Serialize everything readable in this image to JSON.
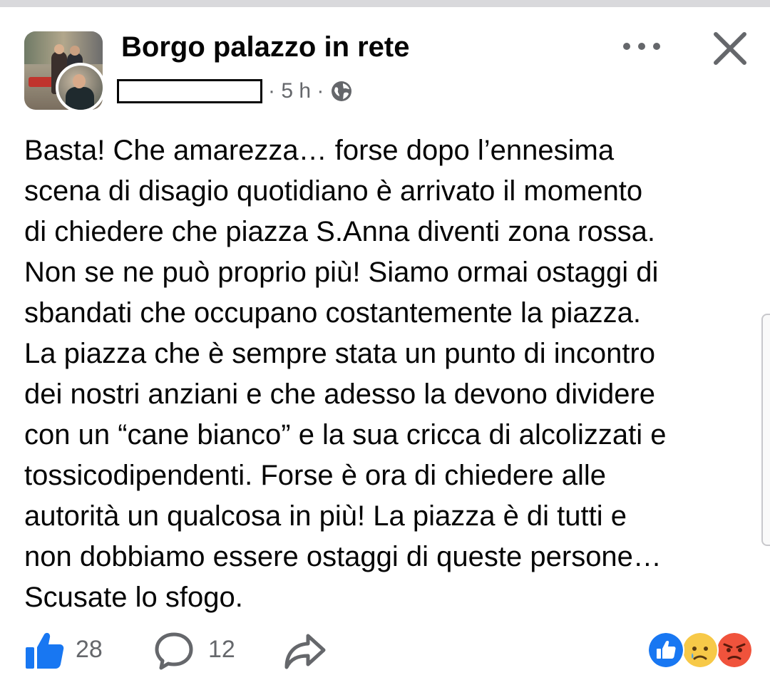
{
  "post": {
    "page_name": "Borgo palazzo in rete",
    "author_name": "",
    "meta": "· 5 h ·",
    "visibility_icon": "globe-icon",
    "body": "Basta! Che amarezza… forse dopo l’ennesima\nscena di disagio quotidiano è arrivato il momento\ndi chiedere che piazza S.Anna diventi zona rossa.\nNon se ne può proprio più! Siamo ormai ostaggi di\nsbandati che occupano costantemente la piazza.\nLa piazza che è sempre stata un punto di incontro\ndei nostri anziani e che adesso la devono dividere\ncon un “cane bianco” e la sua cricca di alcolizzati e\ntossicodipendenti. Forse è ora di chiedere alle\nautorità un qualcosa in più! La piazza è di tutti e\nnon dobbiamo essere ostaggi di queste persone…\nScusate lo sfogo."
  },
  "footer": {
    "like_count": "28",
    "comment_count": "12",
    "reactions": [
      "like-icon",
      "sad-icon",
      "angry-icon"
    ]
  },
  "colors": {
    "accent_blue": "#1877f2",
    "secondary_text": "#65676b",
    "sad_yellow": "#f7c948",
    "angry_red": "#f0533c"
  }
}
